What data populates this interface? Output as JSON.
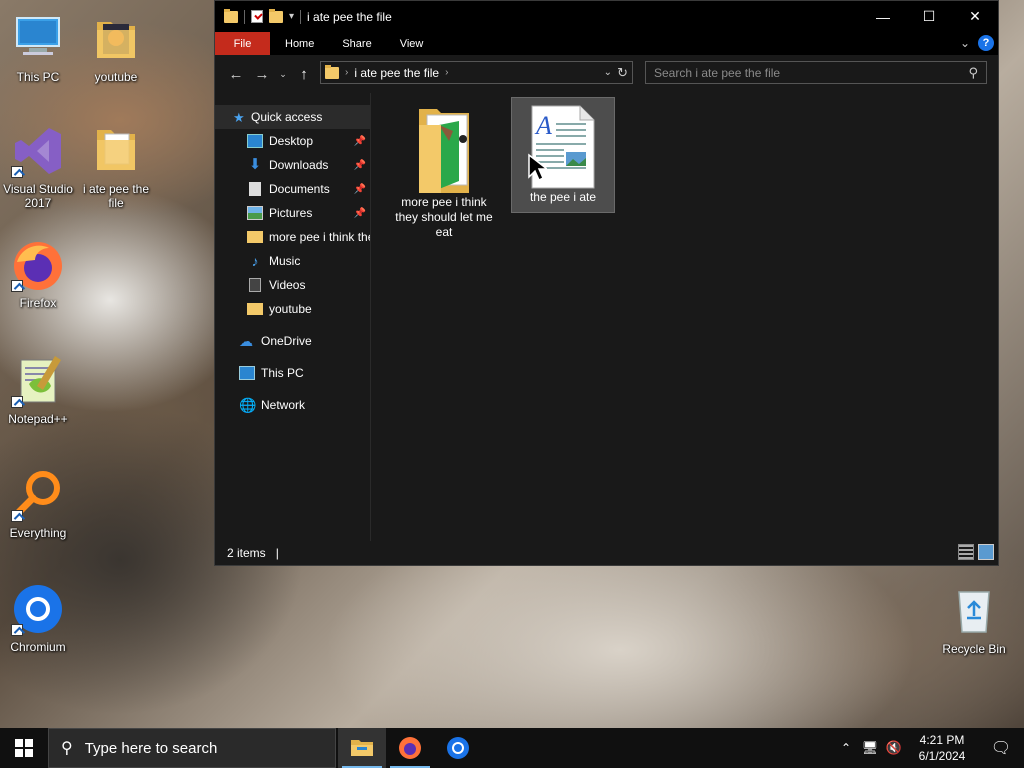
{
  "desktop": {
    "icons": [
      {
        "label": "This PC"
      },
      {
        "label": "youtube"
      },
      {
        "label": "Visual Studio 2017"
      },
      {
        "label": "i ate pee the file"
      },
      {
        "label": "Firefox"
      },
      {
        "label": "Notepad++"
      },
      {
        "label": "Everything"
      },
      {
        "label": "Chromium"
      },
      {
        "label": "Recycle Bin"
      }
    ]
  },
  "window": {
    "title": "i ate pee the file",
    "ribbon_tabs": [
      "File",
      "Home",
      "Share",
      "View"
    ],
    "help_label": "?",
    "address": {
      "path": "i ate pee the file"
    },
    "search": {
      "placeholder": "Search i ate pee the file"
    },
    "nav": {
      "quick_access": "Quick access",
      "items": [
        "Desktop",
        "Downloads",
        "Documents",
        "Pictures",
        "more pee i think they should let me eat",
        "Music",
        "Videos",
        "youtube"
      ],
      "onedrive": "OneDrive",
      "this_pc": "This PC",
      "network": "Network"
    },
    "files": [
      {
        "label": "more pee i think they should let me eat",
        "type": "folder"
      },
      {
        "label": "the pee i ate",
        "type": "document"
      }
    ],
    "status": {
      "count": "2 items"
    }
  },
  "taskbar": {
    "search_placeholder": "Type here to search",
    "time": "4:21 PM",
    "date": "6/1/2024"
  },
  "colors": {
    "accent": "#c42b1c",
    "selection": "#4d4d4d",
    "folder": "#f3c969"
  }
}
